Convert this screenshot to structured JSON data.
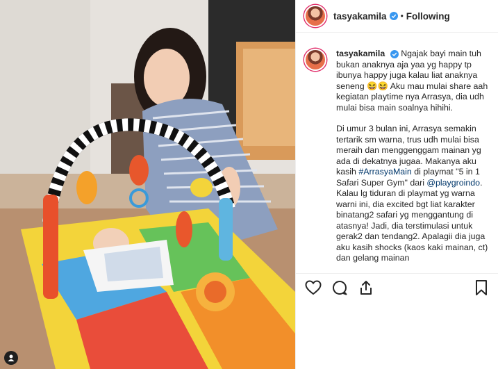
{
  "post": {
    "username": "tasyakamila",
    "separator": "•",
    "follow_state": "Following"
  },
  "caption": {
    "username": "tasyakamila",
    "p1": "Ngajak bayi main tuh bukan anaknya aja yaa yg happy tp ibunya happy juga kalau liat anaknya seneng 😆😆 Aku mau mulai share aah kegiatan playtime nya Arrasya, dia udh mulai bisa main soalnya hihihi.",
    "p2_a": "Di umur 3 bulan ini, Arrasya semakin tertarik sm warna, trus udh mulai bisa meraih dan menggenggam mainan yg ada di dekatnya jugaa. Makanya aku kasih ",
    "hashtag": "#ArrasyaMain",
    "p2_b": " di playmat \"5 in 1 Safari Super Gym\" dari ",
    "mention": "@playgroindo",
    "p2_c": ". Kalau lg tiduran di playmat yg warna warni ini, dia excited bgt liat karakter binatang2 safari yg menggantung di atasnya! Jadi, dia terstimulasi untuk gerak2 dan tendang2. Apalagii dia juga aku kasih shocks (kaos kaki mainan, ct) dan gelang mainan"
  },
  "icons": {
    "verified": "verified-badge-icon",
    "like": "heart-icon",
    "comment": "comment-bubble-icon",
    "share": "share-icon",
    "save": "bookmark-icon",
    "photo_badge": "tagged-user-icon"
  },
  "colors": {
    "verified": "#3897f0",
    "link": "#00376b",
    "text": "#262626",
    "border": "#efefef"
  }
}
